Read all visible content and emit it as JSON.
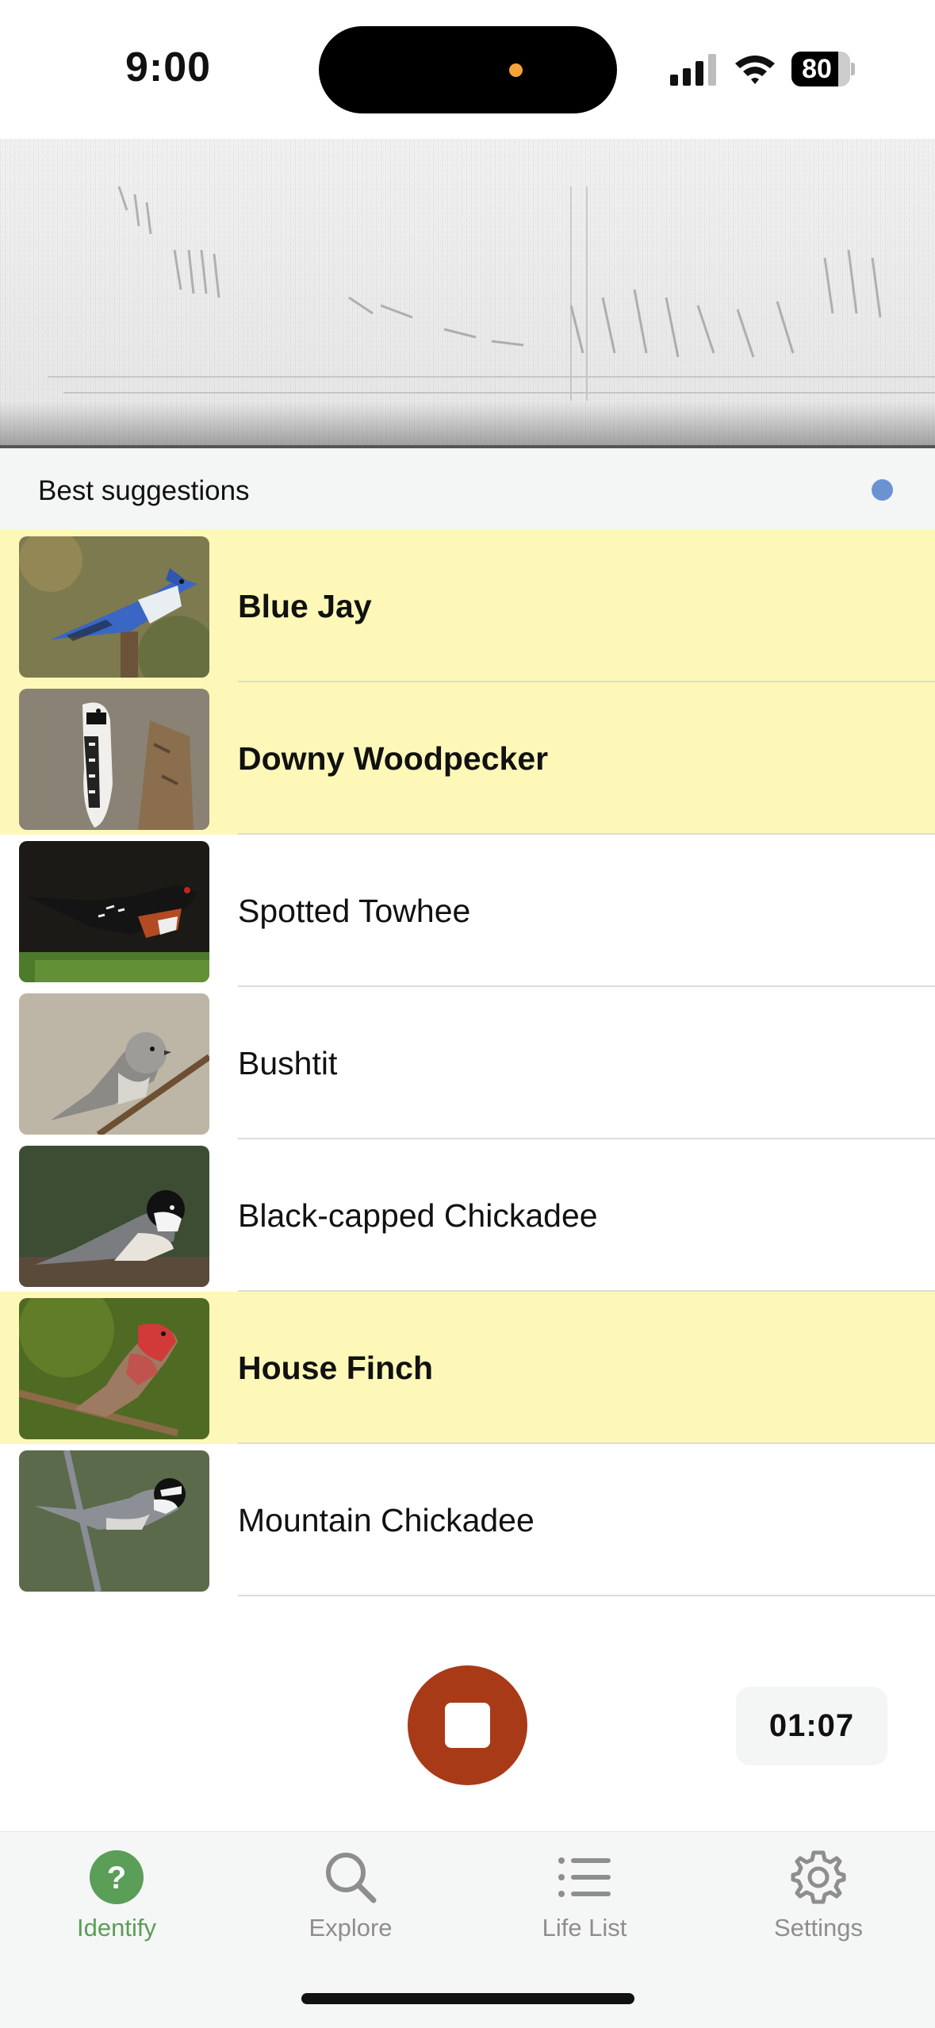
{
  "status_bar": {
    "time": "9:00",
    "battery_percent": 80,
    "battery_label": "80",
    "island_dot_color": "#f4a23a",
    "signal_icon": "cellular-signal-icon",
    "wifi_icon": "wifi-icon"
  },
  "spectrogram": {
    "icon": "spectrogram-image"
  },
  "suggestions": {
    "header": "Best suggestions",
    "indicator_color": "#6b93d2",
    "highlight_color": "#fdf8b8",
    "items": [
      {
        "name": "Blue Jay",
        "highlighted": true,
        "photo": "blue-jay-photo"
      },
      {
        "name": "Downy Woodpecker",
        "highlighted": true,
        "photo": "downy-woodpecker-photo"
      },
      {
        "name": "Spotted Towhee",
        "highlighted": false,
        "photo": "spotted-towhee-photo"
      },
      {
        "name": "Bushtit",
        "highlighted": false,
        "photo": "bushtit-photo"
      },
      {
        "name": "Black-capped Chickadee",
        "highlighted": false,
        "photo": "black-capped-chickadee-photo"
      },
      {
        "name": "House Finch",
        "highlighted": true,
        "photo": "house-finch-photo"
      },
      {
        "name": "Mountain Chickadee",
        "highlighted": false,
        "photo": "mountain-chickadee-photo"
      }
    ]
  },
  "recorder": {
    "stop_icon": "stop-icon",
    "button_color": "#a83a17",
    "elapsed": "01:07"
  },
  "tab_bar": {
    "active_color": "#5a9e58",
    "inactive_color": "#8e8e8e",
    "tabs": [
      {
        "label": "Identify",
        "icon": "question-circle-icon",
        "active": true
      },
      {
        "label": "Explore",
        "icon": "search-icon",
        "active": false
      },
      {
        "label": "Life List",
        "icon": "list-icon",
        "active": false
      },
      {
        "label": "Settings",
        "icon": "gear-icon",
        "active": false
      }
    ]
  }
}
